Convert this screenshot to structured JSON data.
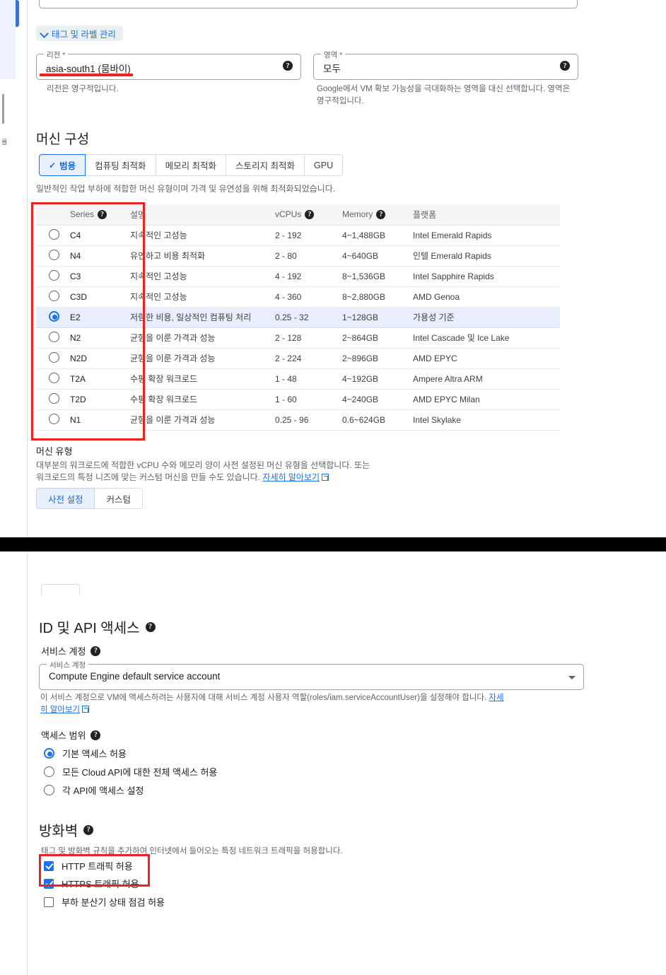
{
  "top_panel": {
    "tags_chip": {
      "label": "태그 및 라벨 관리",
      "icon": "chevron-down-icon"
    },
    "region_field": {
      "legend": "리전 *",
      "value": "asia-south1 (뭄바이)",
      "hint": "리전은 영구적입니다."
    },
    "zone_field": {
      "legend": "영역 *",
      "value": "모두",
      "hint": "Google에서 VM 확보 가능성을 극대화하는 영역을 대신 선택합니다. 영역은 영구적입니다."
    },
    "machine_config": {
      "title": "머신 구성",
      "tabs": [
        {
          "label": "범용",
          "active": true
        },
        {
          "label": "컴퓨팅 최적화",
          "active": false
        },
        {
          "label": "메모리 최적화",
          "active": false
        },
        {
          "label": "스토리지 최적화",
          "active": false
        },
        {
          "label": "GPU",
          "active": false
        }
      ],
      "tabs_description": "일반적인 작업 부하에 적합한 머신 유형이며 가격 및 유연성을 위해 최적화되었습니다."
    },
    "series_table": {
      "headers": [
        "",
        "Series",
        "설명",
        "vCPUs",
        "Memory",
        "플랫폼"
      ],
      "rows": [
        {
          "selected": false,
          "series": "C4",
          "desc": "지속적인 고성능",
          "vcpus": "2 - 192",
          "memory": "4~1,488GB",
          "platform": "Intel Emerald Rapids"
        },
        {
          "selected": false,
          "series": "N4",
          "desc": "유연하고 비용 최적화",
          "vcpus": "2 - 80",
          "memory": "4~640GB",
          "platform": "인텔 Emerald Rapids"
        },
        {
          "selected": false,
          "series": "C3",
          "desc": "지속적인 고성능",
          "vcpus": "4 - 192",
          "memory": "8~1,536GB",
          "platform": "Intel Sapphire Rapids"
        },
        {
          "selected": false,
          "series": "C3D",
          "desc": "지속적인 고성능",
          "vcpus": "4 - 360",
          "memory": "8~2,880GB",
          "platform": "AMD Genoa"
        },
        {
          "selected": true,
          "series": "E2",
          "desc": "저렴한 비용, 일상적인 컴퓨팅 처리",
          "vcpus": "0.25 - 32",
          "memory": "1~128GB",
          "platform": "가용성 기준"
        },
        {
          "selected": false,
          "series": "N2",
          "desc": "균형을 이룬 가격과 성능",
          "vcpus": "2 - 128",
          "memory": "2~864GB",
          "platform": "Intel Cascade 및 Ice Lake"
        },
        {
          "selected": false,
          "series": "N2D",
          "desc": "균형을 이룬 가격과 성능",
          "vcpus": "2 - 224",
          "memory": "2~896GB",
          "platform": "AMD EPYC"
        },
        {
          "selected": false,
          "series": "T2A",
          "desc": "수평 확장 워크로드",
          "vcpus": "1 - 48",
          "memory": "4~192GB",
          "platform": "Ampere Altra ARM"
        },
        {
          "selected": false,
          "series": "T2D",
          "desc": "수평 확장 워크로드",
          "vcpus": "1 - 60",
          "memory": "4~240GB",
          "platform": "AMD EPYC Milan"
        },
        {
          "selected": false,
          "series": "N1",
          "desc": "균형을 이룬 가격과 성능",
          "vcpus": "0.25 - 96",
          "memory": "0.6~624GB",
          "platform": "Intel Skylake"
        }
      ]
    },
    "machine_type": {
      "title": "머신 유형",
      "description_line1": "대부분의 워크로드에 적합한 vCPU 수와 메모리 양이 사전 설정된 머신 유형을 선택합니다. 또는",
      "description_line2": "워크로드의 특정 니즈에 맞는 커스텀 머신을 만들 수도 있습니다.",
      "learn_more": "자세히 알아보기",
      "buttons": [
        {
          "label": "사전 설정",
          "active": true
        },
        {
          "label": "커스텀",
          "active": false
        }
      ]
    }
  },
  "bottom_panel": {
    "identity_section": {
      "title": "ID 및 API 액세스",
      "service_account_label": "서비스 계정",
      "service_account_field": {
        "legend": "서비스 계정",
        "value": "Compute Engine default service account"
      },
      "service_account_hint_1": "이 서비스 계정으로 VM에 액세스하려는 사용자에 대해 서비스 계정 사용자 역할(roles/iam.serviceAccountUser)을 설정해야 합니다.",
      "service_account_hint_link_1": "자세",
      "service_account_hint_link_2": "히 알아보기",
      "access_scope_label": "액세스 범위",
      "access_scopes": [
        {
          "label": "기본 액세스 허용",
          "selected": true
        },
        {
          "label": "모든 Cloud API에 대한 전체 액세스 허용",
          "selected": false
        },
        {
          "label": "각 API에 액세스 설정",
          "selected": false
        }
      ]
    },
    "firewall_section": {
      "title": "방화벽",
      "description": "태그 및 방화벽 규칙을 추가하여 인터넷에서 들어오는 특정 네트워크 트래픽을 허용합니다.",
      "options": [
        {
          "label": "HTTP 트래픽 허용",
          "checked": true
        },
        {
          "label": "HTTPS 트래픽 허용",
          "checked": true
        },
        {
          "label": "부하 분산기 상태 점검 허용",
          "checked": false
        }
      ]
    }
  },
  "annotations": {
    "accent_red": "#ef2020",
    "accent_blue": "#1a73e8",
    "selected_row_bg": "#e8eefc"
  }
}
